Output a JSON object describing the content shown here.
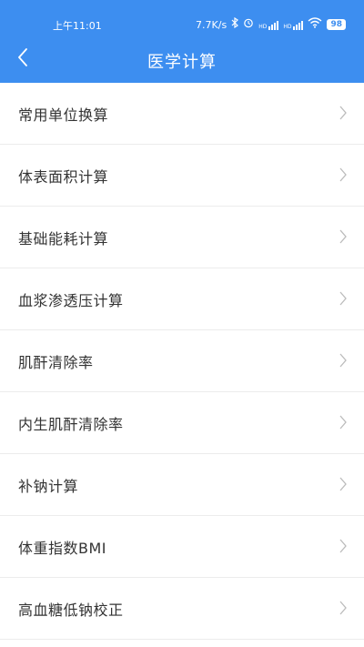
{
  "status_bar": {
    "time": "上午11:01",
    "net_speed": "7.7K/s",
    "signal_1": "HD",
    "signal_2": "HD",
    "battery": "98"
  },
  "header": {
    "title": "医学计算",
    "back_icon": "chevron-left-icon"
  },
  "list": {
    "items": [
      {
        "label": "常用单位换算"
      },
      {
        "label": "体表面积计算"
      },
      {
        "label": "基础能耗计算"
      },
      {
        "label": "血浆渗透压计算"
      },
      {
        "label": "肌酐清除率"
      },
      {
        "label": "内生肌酐清除率"
      },
      {
        "label": "补钠计算"
      },
      {
        "label": "体重指数BMI"
      },
      {
        "label": "高血糖低钠校正"
      }
    ]
  },
  "colors": {
    "accent": "#3d8ef0",
    "text": "#333333",
    "divider": "#ececec",
    "chevron": "#bbbbbb"
  }
}
